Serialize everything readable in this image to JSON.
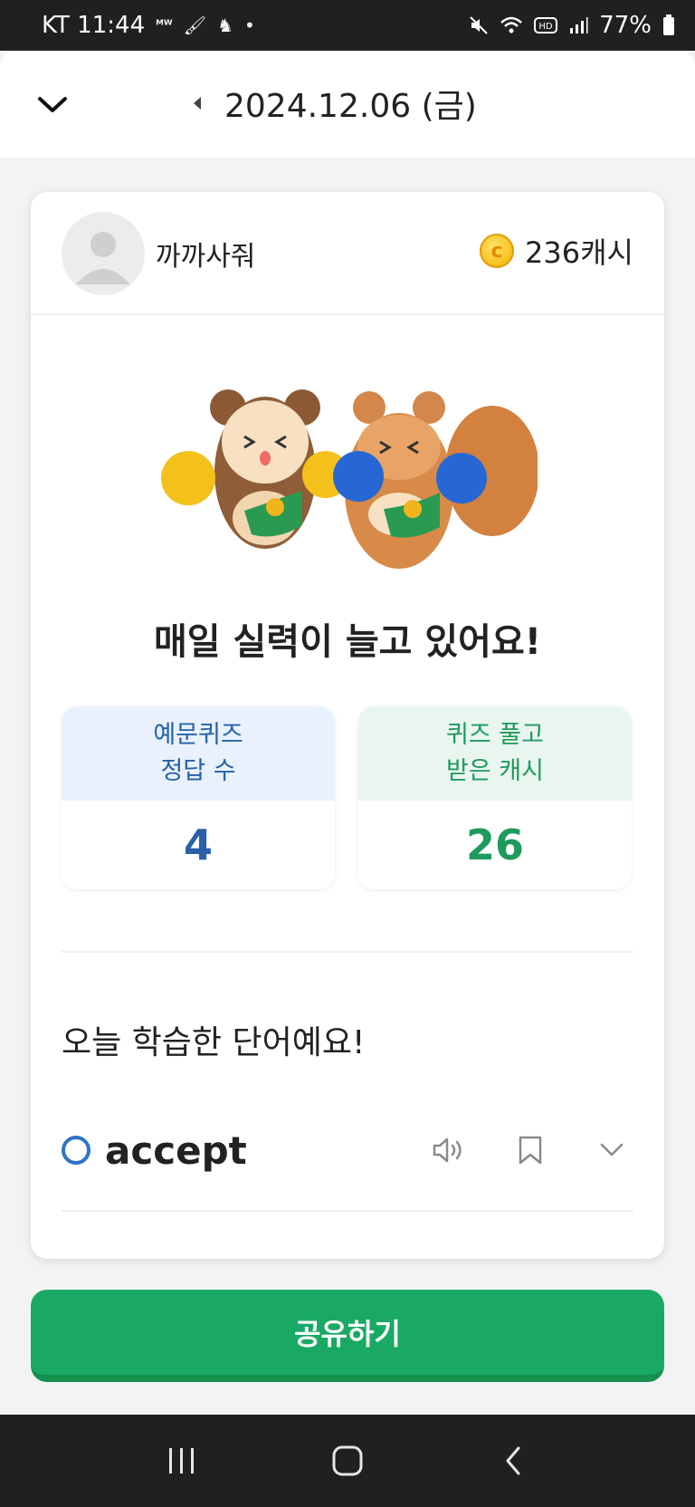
{
  "status_bar": {
    "carrier_time": "KT 11:44",
    "battery": "77%",
    "icons_left": [
      "mw-icon",
      "notification-icon",
      "notification-icon-2",
      "dot-icon"
    ],
    "icons_right": [
      "mute-icon",
      "wifi-icon",
      "hd-icon",
      "signal-icon",
      "battery-icon"
    ]
  },
  "header": {
    "date": "2024.12.06 (금)"
  },
  "profile": {
    "nickname": "까까사줘",
    "cash": "236캐시"
  },
  "headline": "매일 실력이 늘고 있어요!",
  "stats": [
    {
      "label_line1": "예문퀴즈",
      "label_line2": "정답 수",
      "value": "4",
      "color": "#2a60a8"
    },
    {
      "label_line1": "퀴즈 풀고",
      "label_line2": "받은 캐시",
      "value": "26",
      "color": "#1f9a5e"
    }
  ],
  "section_title": "오늘 학습한 단어예요!",
  "words": [
    {
      "mark": "O",
      "word": "accept"
    }
  ],
  "share_button": "공유하기",
  "colors": {
    "accent_green": "#1aa964",
    "accent_blue": "#2e74c7"
  }
}
